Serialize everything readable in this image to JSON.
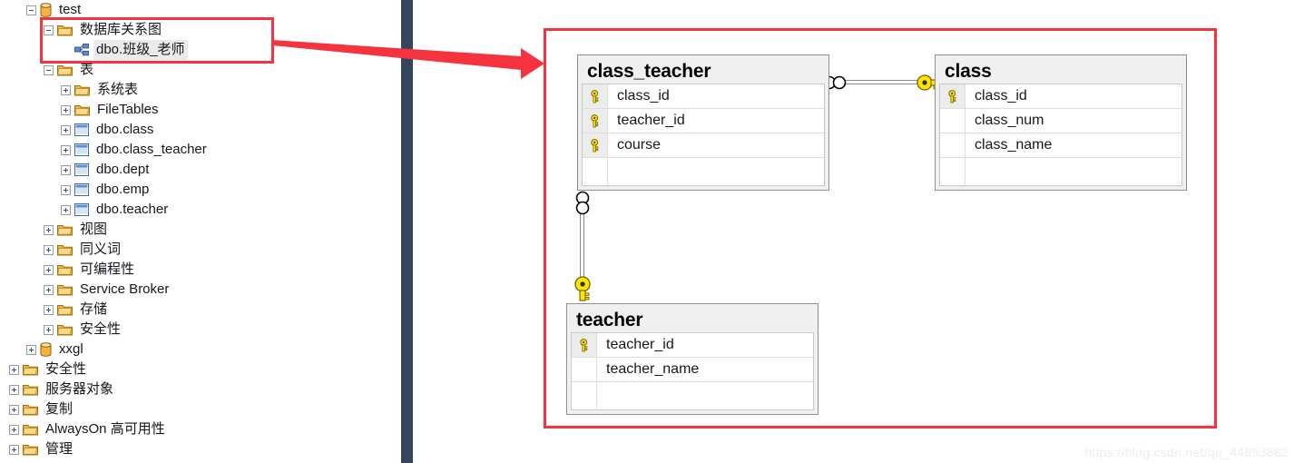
{
  "tree": {
    "nodes": [
      {
        "label": "test",
        "indent": 0,
        "icon": "database-icon",
        "expander": "minus",
        "selected": false
      },
      {
        "label": "数据库关系图",
        "indent": 1,
        "icon": "folder-icon",
        "expander": "minus",
        "selected": false
      },
      {
        "label": "dbo.班级_老师",
        "indent": 2,
        "icon": "diagram-icon",
        "expander": "none",
        "selected": true
      },
      {
        "label": "表",
        "indent": 1,
        "icon": "folder-icon",
        "expander": "minus",
        "selected": false
      },
      {
        "label": "系统表",
        "indent": 2,
        "icon": "folder-icon",
        "expander": "plus",
        "selected": false
      },
      {
        "label": "FileTables",
        "indent": 2,
        "icon": "folder-icon",
        "expander": "plus",
        "selected": false
      },
      {
        "label": "dbo.class",
        "indent": 2,
        "icon": "table-icon",
        "expander": "plus",
        "selected": false
      },
      {
        "label": "dbo.class_teacher",
        "indent": 2,
        "icon": "table-icon",
        "expander": "plus",
        "selected": false
      },
      {
        "label": "dbo.dept",
        "indent": 2,
        "icon": "table-icon",
        "expander": "plus",
        "selected": false
      },
      {
        "label": "dbo.emp",
        "indent": 2,
        "icon": "table-icon",
        "expander": "plus",
        "selected": false
      },
      {
        "label": "dbo.teacher",
        "indent": 2,
        "icon": "table-icon",
        "expander": "plus",
        "selected": false
      },
      {
        "label": "视图",
        "indent": 1,
        "icon": "folder-icon",
        "expander": "plus",
        "selected": false
      },
      {
        "label": "同义词",
        "indent": 1,
        "icon": "folder-icon",
        "expander": "plus",
        "selected": false
      },
      {
        "label": "可编程性",
        "indent": 1,
        "icon": "folder-icon",
        "expander": "plus",
        "selected": false
      },
      {
        "label": "Service Broker",
        "indent": 1,
        "icon": "folder-icon",
        "expander": "plus",
        "selected": false
      },
      {
        "label": "存储",
        "indent": 1,
        "icon": "folder-icon",
        "expander": "plus",
        "selected": false
      },
      {
        "label": "安全性",
        "indent": 1,
        "icon": "folder-icon",
        "expander": "plus",
        "selected": false
      },
      {
        "label": "xxgl",
        "indent": 0,
        "icon": "database-icon",
        "expander": "plus",
        "selected": false
      },
      {
        "label": "安全性",
        "indent": -1,
        "icon": "folder-icon",
        "expander": "plus",
        "selected": false
      },
      {
        "label": "服务器对象",
        "indent": -1,
        "icon": "folder-icon",
        "expander": "plus",
        "selected": false
      },
      {
        "label": "复制",
        "indent": -1,
        "icon": "folder-icon",
        "expander": "plus",
        "selected": false
      },
      {
        "label": "AlwaysOn 高可用性",
        "indent": -1,
        "icon": "folder-icon",
        "expander": "plus",
        "selected": false
      },
      {
        "label": "管理",
        "indent": -1,
        "icon": "folder-icon",
        "expander": "plus",
        "selected": false
      }
    ]
  },
  "diagram": {
    "entities": [
      {
        "name": "class_teacher",
        "columns": [
          {
            "name": "class_id",
            "key": true
          },
          {
            "name": "teacher_id",
            "key": true
          },
          {
            "name": "course",
            "key": true
          }
        ]
      },
      {
        "name": "class",
        "columns": [
          {
            "name": "class_id",
            "key": true
          },
          {
            "name": "class_num",
            "key": false
          },
          {
            "name": "class_name",
            "key": false
          }
        ]
      },
      {
        "name": "teacher",
        "columns": [
          {
            "name": "teacher_id",
            "key": true
          },
          {
            "name": "teacher_name",
            "key": false
          }
        ]
      }
    ],
    "relationships": [
      {
        "from": "class_teacher",
        "to": "class",
        "from_cardinality": "many",
        "to_cardinality": "one",
        "orientation": "horizontal"
      },
      {
        "from": "class_teacher",
        "to": "teacher",
        "from_cardinality": "many",
        "to_cardinality": "one",
        "orientation": "vertical"
      }
    ]
  },
  "annotations": {
    "highlight_color": "#f5333f",
    "arrow_color": "#f5333f",
    "divider_color": "#34465e"
  },
  "watermark": {
    "text": "https://blog.csdn.net/qq_44853882"
  }
}
